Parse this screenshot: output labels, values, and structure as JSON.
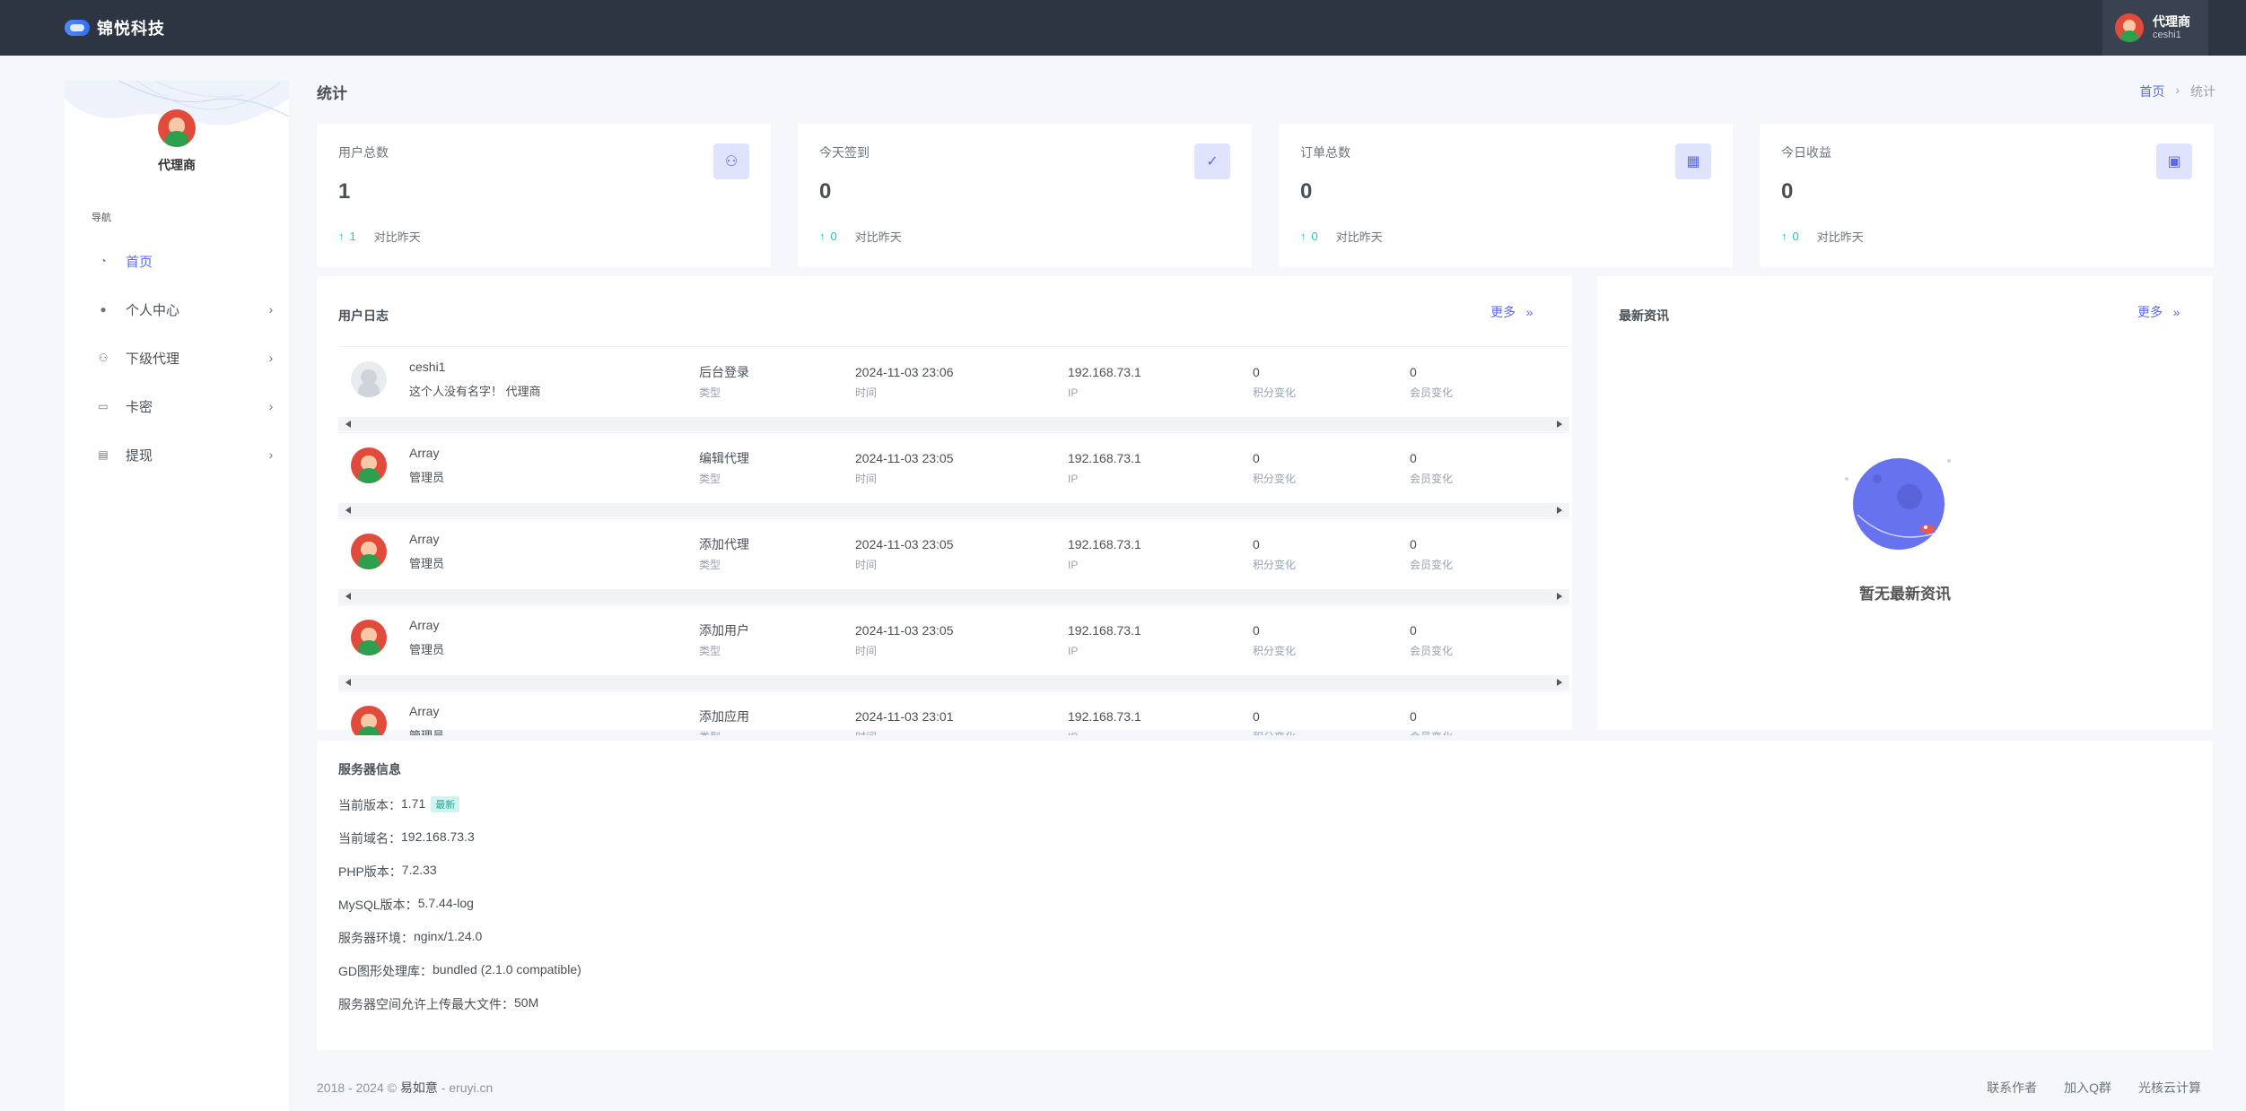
{
  "header": {
    "logo_text": "锦悦科技",
    "user_name": "代理商",
    "user_sub": "ceshi1"
  },
  "sidebar": {
    "role": "代理商",
    "nav_title": "导航",
    "items": [
      {
        "label": "首页",
        "icon": "dashboard-icon",
        "active": true,
        "has_children": false
      },
      {
        "label": "个人中心",
        "icon": "person-icon",
        "active": false,
        "has_children": true
      },
      {
        "label": "下级代理",
        "icon": "group-icon",
        "active": false,
        "has_children": true
      },
      {
        "label": "卡密",
        "icon": "card-icon",
        "active": false,
        "has_children": true
      },
      {
        "label": "提现",
        "icon": "withdraw-icon",
        "active": false,
        "has_children": true
      }
    ]
  },
  "page": {
    "title": "统计",
    "breadcrumb": [
      "首页",
      "统计"
    ]
  },
  "stats": [
    {
      "label": "用户总数",
      "value": "1",
      "trend": "1",
      "compare": "对比昨天",
      "icon": "users-icon"
    },
    {
      "label": "今天签到",
      "value": "0",
      "trend": "0",
      "compare": "对比昨天",
      "icon": "user-check-icon"
    },
    {
      "label": "订单总数",
      "value": "0",
      "trend": "0",
      "compare": "对比昨天",
      "icon": "calendar-icon"
    },
    {
      "label": "今日收益",
      "value": "0",
      "trend": "0",
      "compare": "对比昨天",
      "icon": "money-icon"
    }
  ],
  "logs": {
    "title": "用户日志",
    "more": "更多",
    "captions": {
      "type": "类型",
      "time": "时间",
      "ip": "IP",
      "points": "积分变化",
      "member": "会员变化"
    },
    "rows": [
      {
        "name": "ceshi1",
        "sub": "这个人没有名字！ 代理商",
        "avatar": "gray",
        "type": "后台登录",
        "time": "2024-11-03 23:06",
        "ip": "192.168.73.1",
        "points": "0",
        "member": "0"
      },
      {
        "name": "Array",
        "sub": "管理员",
        "avatar": "color",
        "type": "编辑代理",
        "time": "2024-11-03 23:05",
        "ip": "192.168.73.1",
        "points": "0",
        "member": "0"
      },
      {
        "name": "Array",
        "sub": "管理员",
        "avatar": "color",
        "type": "添加代理",
        "time": "2024-11-03 23:05",
        "ip": "192.168.73.1",
        "points": "0",
        "member": "0"
      },
      {
        "name": "Array",
        "sub": "管理员",
        "avatar": "color",
        "type": "添加用户",
        "time": "2024-11-03 23:05",
        "ip": "192.168.73.1",
        "points": "0",
        "member": "0"
      },
      {
        "name": "Array",
        "sub": "管理员",
        "avatar": "color",
        "type": "添加应用",
        "time": "2024-11-03 23:01",
        "ip": "192.168.73.1",
        "points": "0",
        "member": "0"
      }
    ]
  },
  "news": {
    "title": "最新资讯",
    "more": "更多",
    "empty": "暂无最新资讯"
  },
  "server": {
    "title": "服务器信息",
    "lines": [
      {
        "label": "当前版本：",
        "value": "1.71",
        "badge": "最新"
      },
      {
        "label": "当前域名：",
        "value": "192.168.73.3"
      },
      {
        "label": "PHP版本：",
        "value": "7.2.33"
      },
      {
        "label": "MySQL版本：",
        "value": "5.7.44-log"
      },
      {
        "label": "服务器环境：",
        "value": "nginx/1.24.0"
      },
      {
        "label": "GD图形处理库：",
        "value": "bundled (2.1.0 compatible)"
      },
      {
        "label": "服务器空间允许上传最大文件：",
        "value": "50M"
      }
    ]
  },
  "footer": {
    "prefix": "2018 - 2024 © ",
    "brand": "易如意",
    "suffix": " - eruyi.cn",
    "links": [
      "联系作者",
      "加入Q群",
      "光核云计算"
    ]
  },
  "colors": {
    "topbar": "#2d3442",
    "accent": "#5b6be8",
    "trend": "#1ecab8"
  }
}
